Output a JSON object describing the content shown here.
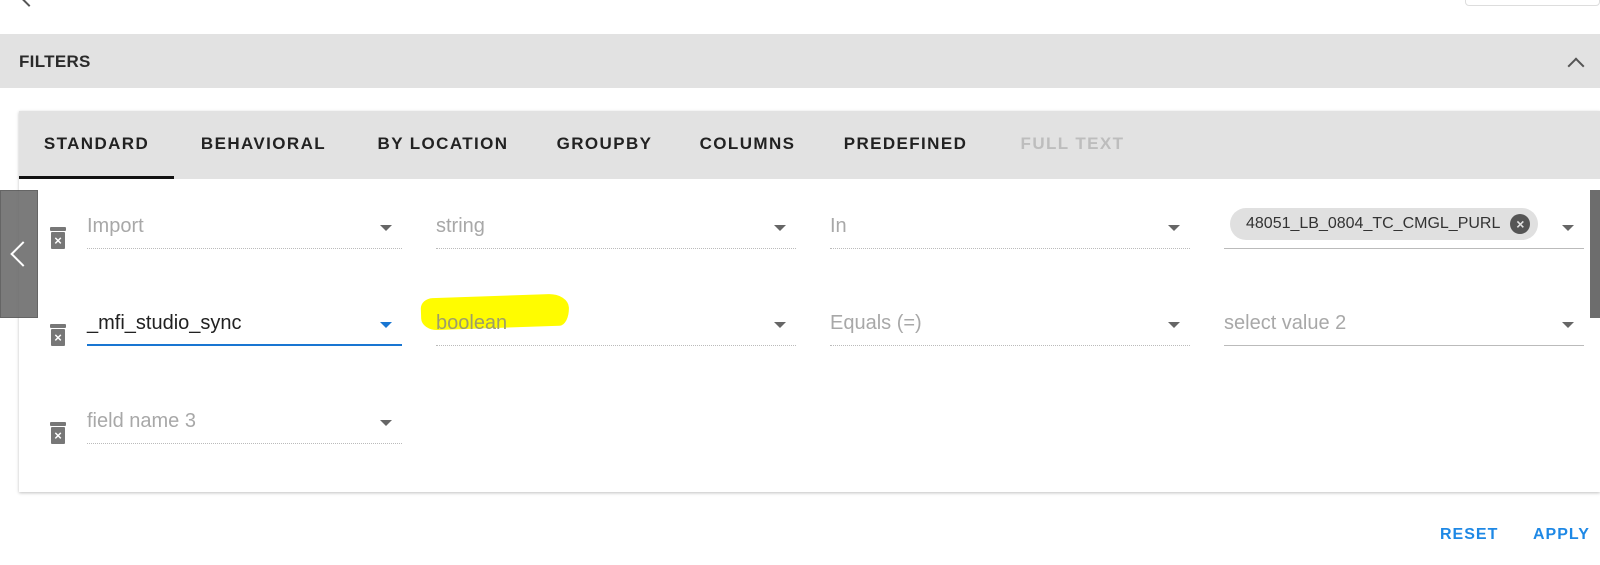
{
  "filters_label": "FILTERS",
  "tabs": [
    {
      "label": "STANDARD",
      "state": "active"
    },
    {
      "label": "BEHAVIORAL",
      "state": "normal"
    },
    {
      "label": "BY LOCATION",
      "state": "normal"
    },
    {
      "label": "GROUPBY",
      "state": "normal"
    },
    {
      "label": "COLUMNS",
      "state": "normal"
    },
    {
      "label": "PREDEFINED",
      "state": "normal"
    },
    {
      "label": "FULL TEXT",
      "state": "disabled"
    }
  ],
  "rows": [
    {
      "field": "Import",
      "type": "string",
      "operator": "In",
      "value_chip": "48051_LB_0804_TC_CMGL_PURL"
    },
    {
      "field": "_mfi_studio_sync",
      "type": "boolean",
      "operator": "Equals (=)",
      "value_placeholder": "select value 2"
    },
    {
      "field_placeholder": "field name 3"
    }
  ],
  "actions": {
    "reset": "RESET",
    "apply": "APPLY"
  },
  "colors": {
    "accent": "#1e88e5",
    "focus_underline": "#1976d2",
    "highlight": "#fffc00",
    "header_bg": "#e2e2e2"
  }
}
